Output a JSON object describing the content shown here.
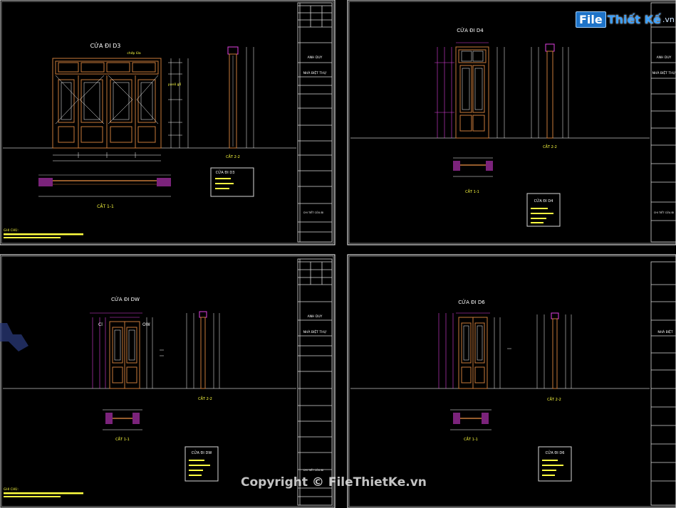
{
  "watermark": {
    "logo_box": "File",
    "logo_rest": "Thiết Kế",
    "logo_domain": ".vn",
    "copyright": "Copyright © FileThietKe.vn"
  },
  "colors": {
    "frame": "#d8d8d8",
    "door": "#c87a3a",
    "dim": "#e040e0",
    "text": "#ffffff",
    "title": "#ffff40",
    "ground": "#bfbfbf"
  },
  "sheets": [
    {
      "title": "CỬA ĐI D3",
      "label_top": "chớp lửa",
      "label_side": "panô gỗ",
      "section_label": "CẮT 2-2",
      "plan_label": "CẮT 1-1",
      "legend_title": "CỬA ĐI D3",
      "tb_client": "ANH DUY",
      "tb_project": "NHÀ BIỆT THỰ",
      "tb_drawing": "CHI TIẾT CỬA ĐI",
      "notes_label": "GHI CHÚ:"
    },
    {
      "title": "CỬA ĐI D4",
      "section_label": "CẮT 2-2",
      "plan_label": "CẮT 1-1",
      "legend_title": "CỬA ĐI D4",
      "tb_client": "ANH DUY",
      "tb_project": "NHÀ BIỆT THỰ",
      "tb_drawing": "CHI TIẾT CỬA ĐI"
    },
    {
      "title": "CỬA ĐI DW",
      "label_left": "Cl",
      "label_right": "OW",
      "section_label": "CẮT 2-2",
      "plan_label": "CẮT 1-1",
      "legend_title": "CỬA ĐI DW",
      "tb_client": "ANH DUY",
      "tb_project": "NHÀ BIỆT THỰ",
      "tb_drawing": "CHI TIẾT CỬA ĐI",
      "notes_label": "GHI CHÚ:"
    },
    {
      "title": "CỬA ĐI D6",
      "section_label": "CẮT 2-2",
      "plan_label": "CẮT 1-1",
      "legend_title": "CỬA ĐI D6",
      "tb_project": "NHÀ BIỆT"
    }
  ]
}
